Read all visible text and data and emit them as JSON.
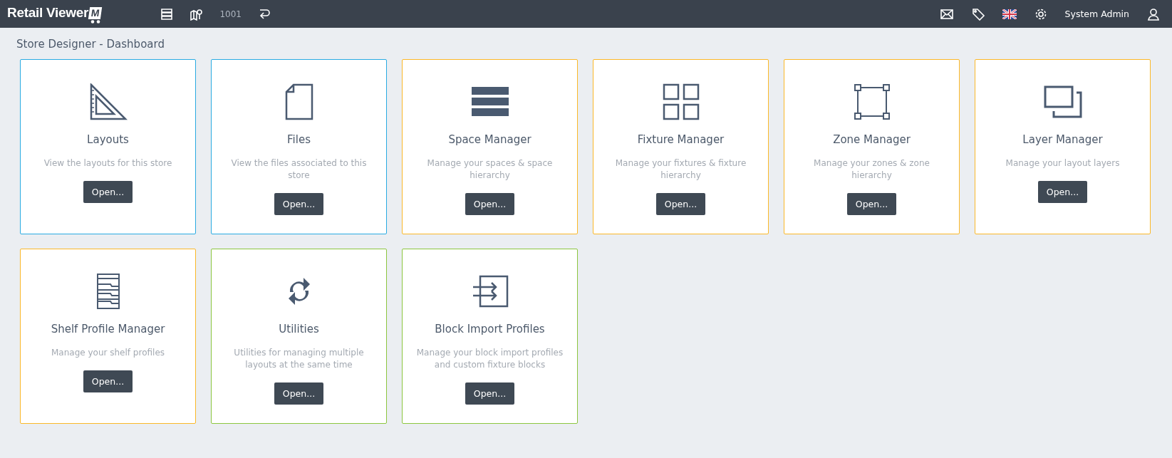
{
  "header": {
    "logo": "Retail Viewer",
    "logo_badge": "M",
    "store_number": "1001",
    "user": "System Admin"
  },
  "page_title": "Store Designer - Dashboard",
  "cards": [
    {
      "title": "Layouts",
      "description": "View the layouts for this store",
      "button": "Open...",
      "color": "#29abe2"
    },
    {
      "title": "Files",
      "description": "View the files associated to this store",
      "button": "Open...",
      "color": "#29abe2"
    },
    {
      "title": "Space Manager",
      "description": "Manage your spaces & space hierarchy",
      "button": "Open...",
      "color": "#fbb829"
    },
    {
      "title": "Fixture Manager",
      "description": "Manage your fixtures & fixture hierarchy",
      "button": "Open...",
      "color": "#fbb829"
    },
    {
      "title": "Zone Manager",
      "description": "Manage your zones & zone hierarchy",
      "button": "Open...",
      "color": "#fbb829"
    },
    {
      "title": "Layer Manager",
      "description": "Manage your layout layers",
      "button": "Open...",
      "color": "#fbb829"
    },
    {
      "title": "Shelf Profile Manager",
      "description": "Manage your shelf profiles",
      "button": "Open...",
      "color": "#fbb829"
    },
    {
      "title": "Utilities",
      "description": "Utilities for managing multiple layouts at the same time",
      "button": "Open...",
      "color": "#8cc63f"
    },
    {
      "title": "Block Import Profiles",
      "description": "Manage your block import profiles and custom fixture blocks",
      "button": "Open...",
      "color": "#8cc63f"
    }
  ]
}
